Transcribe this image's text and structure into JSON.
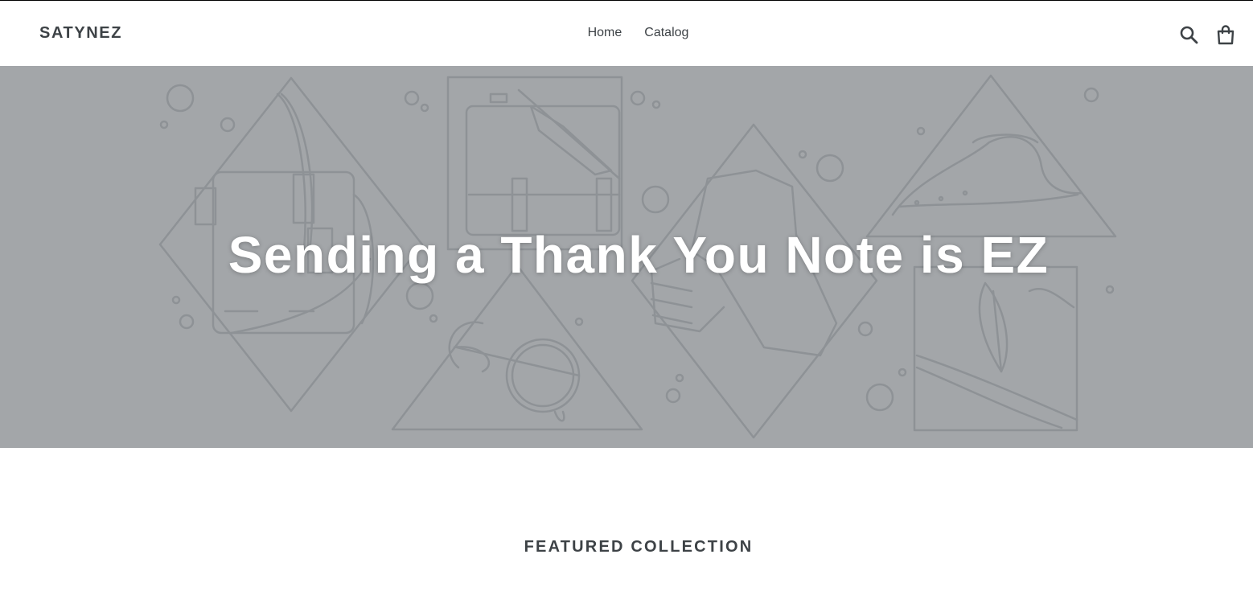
{
  "header": {
    "logo": "SATYNEZ",
    "nav": [
      "Home",
      "Catalog"
    ],
    "search_icon": "search-icon",
    "cart_icon": "cart-icon"
  },
  "hero": {
    "title": "Sending a Thank You Note is EZ",
    "background_color": "#a3a6a9",
    "illustration": [
      "handbag",
      "briefcase",
      "high-heel-shoe",
      "brogue-shoe",
      "sunglasses",
      "feather-hat"
    ]
  },
  "featured": {
    "heading": "FEATURED COLLECTION"
  },
  "colors": {
    "text": "#3d4246",
    "hero_bg": "#a3a6a9",
    "hero_lines": "#8e9296",
    "hero_title": "#ffffff"
  }
}
